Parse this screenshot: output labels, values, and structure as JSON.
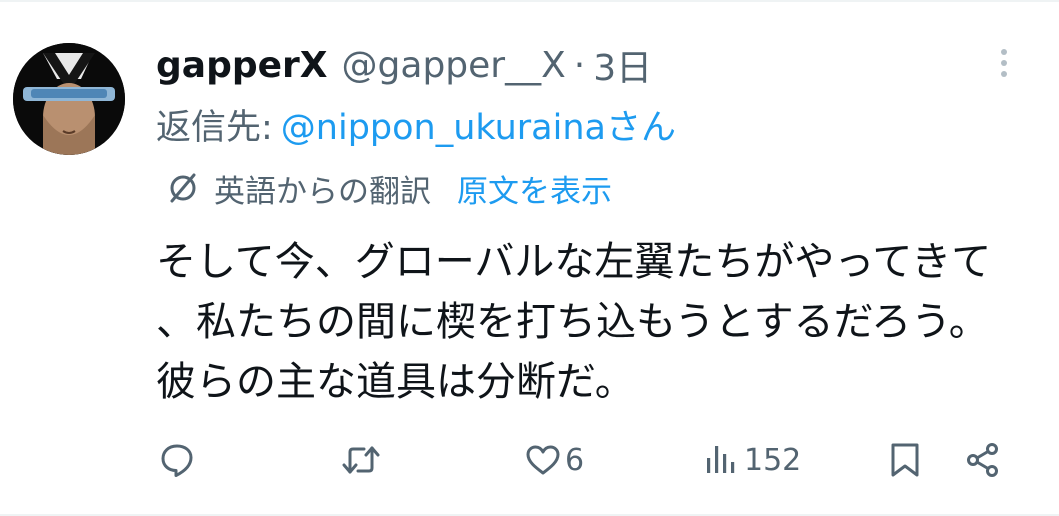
{
  "tweet": {
    "display_name": "gapperX",
    "handle": "@gapper__X",
    "separator": "·",
    "time": "3日",
    "reply_prefix": "返信先:",
    "reply_target": "@nippon_ukurainaさん",
    "translated_from": "英語からの翻訳",
    "show_original": "原文を表示",
    "text": "そして今、グローバルな左翼たちがやってきて、私たちの間に楔を打ち込もうとするだろう。彼らの主な道具は分断だ。"
  },
  "actions": {
    "likes": "6",
    "views": "152"
  },
  "icons": [
    "more-icon",
    "translate-icon",
    "reply-icon",
    "retweet-icon",
    "like-icon",
    "views-icon",
    "bookmark-icon",
    "share-icon"
  ],
  "colors": {
    "text": "#0f1419",
    "secondary": "#536471",
    "accent": "#1d9bf0"
  }
}
